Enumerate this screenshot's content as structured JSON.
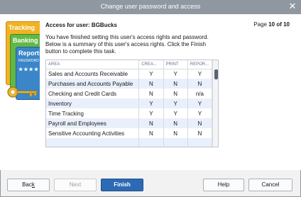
{
  "window": {
    "title": "Change user password and access"
  },
  "art": {
    "card_tracking": "Tracking",
    "card_banking": "Banking",
    "card_reports": "Reports",
    "password_text": "PASSWORD",
    "stars": "★★★★"
  },
  "heading": "Access for user: BGBucks",
  "pager": {
    "prefix": "Page",
    "value": "10 of 10"
  },
  "instructions": "You have finished setting this user's access rights and password. Below is a summary of this user's access rights. Click the Finish button to complete this task.",
  "table": {
    "columns": [
      "AREA",
      "CREA...",
      "PRINT",
      "REPOR..."
    ],
    "rows": [
      {
        "area": "Sales and Accounts Receivable",
        "create": "Y",
        "print": "Y",
        "report": "Y"
      },
      {
        "area": "Purchases and Accounts Payable",
        "create": "N",
        "print": "N",
        "report": "N"
      },
      {
        "area": "Checking and Credit Cards",
        "create": "N",
        "print": "N",
        "report": "n/a"
      },
      {
        "area": "Inventory",
        "create": "Y",
        "print": "Y",
        "report": "Y"
      },
      {
        "area": "Time Tracking",
        "create": "Y",
        "print": "Y",
        "report": "Y"
      },
      {
        "area": "Payroll and Employees",
        "create": "N",
        "print": "N",
        "report": "N"
      },
      {
        "area": "Sensitive Accounting Activities",
        "create": "N",
        "print": "N",
        "report": "N"
      }
    ]
  },
  "buttons": {
    "back_pre": "Bac",
    "back_accel": "k",
    "next": "Next",
    "finish": "Finish",
    "help": "Help",
    "cancel": "Cancel"
  },
  "colors": {
    "titlebar": "#8f97a1",
    "primary_button": "#2d6ab5",
    "row_alt": "#e9f0fb"
  }
}
